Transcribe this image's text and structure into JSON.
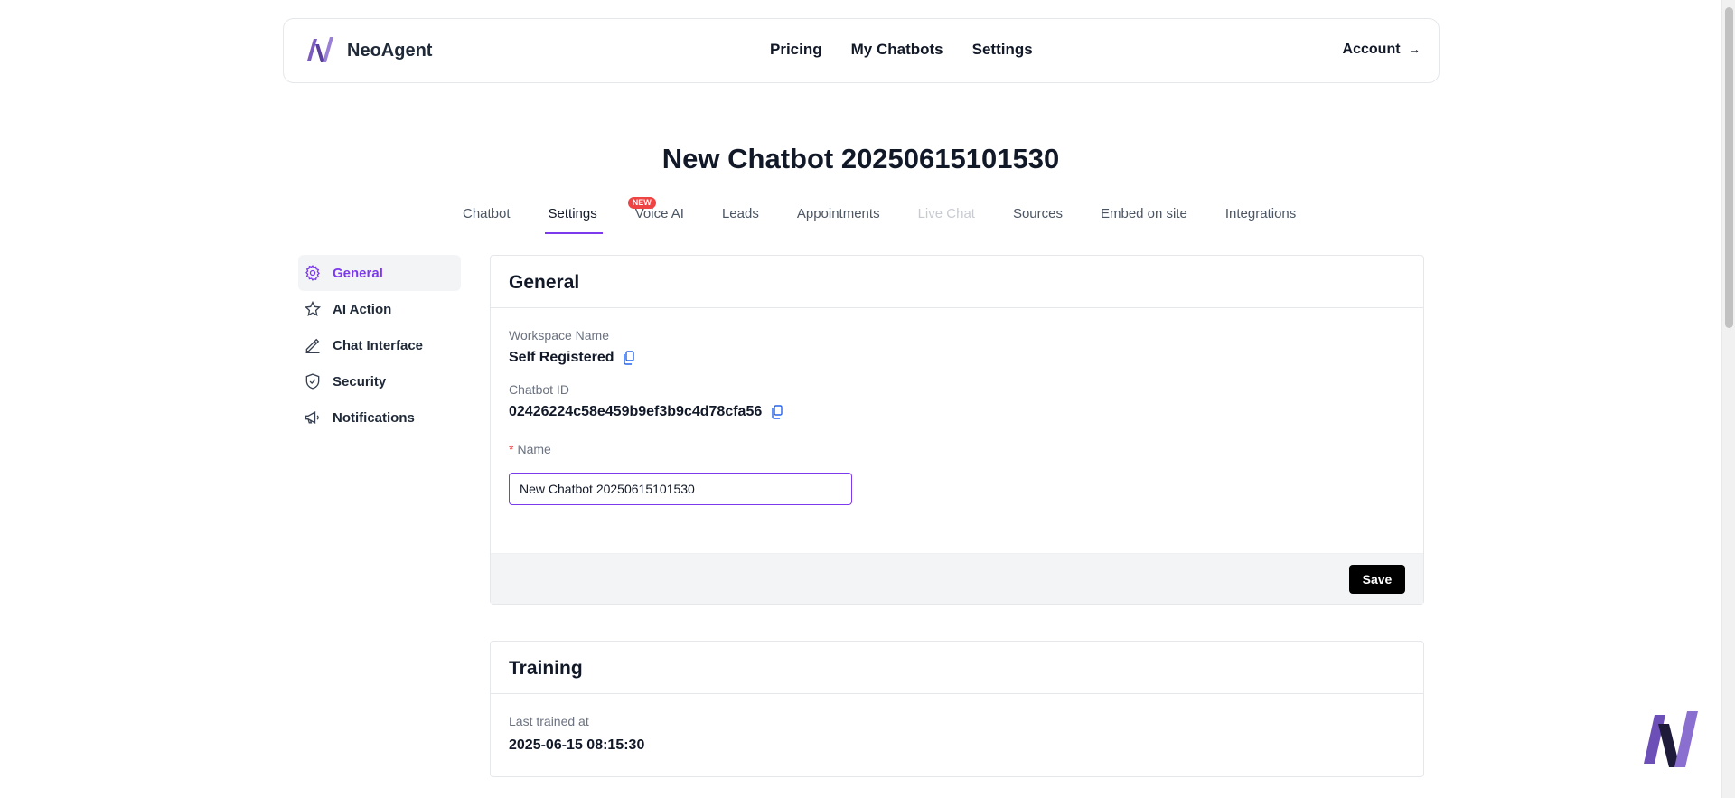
{
  "navbar": {
    "brand_name": "NeoAgent",
    "links": [
      "Pricing",
      "My Chatbots",
      "Settings"
    ],
    "account_label": "Account",
    "account_arrow": "→"
  },
  "page": {
    "title": "New Chatbot 20250615101530"
  },
  "tabs": [
    {
      "label": "Chatbot"
    },
    {
      "label": "Settings",
      "active": true
    },
    {
      "label": "Voice AI",
      "badge": "NEW"
    },
    {
      "label": "Leads"
    },
    {
      "label": "Appointments"
    },
    {
      "label": "Live Chat",
      "disabled": true
    },
    {
      "label": "Sources"
    },
    {
      "label": "Embed on site"
    },
    {
      "label": "Integrations"
    }
  ],
  "sidebar": {
    "items": [
      {
        "label": "General",
        "icon": "gear-icon",
        "active": true
      },
      {
        "label": "AI Action",
        "icon": "star-icon"
      },
      {
        "label": "Chat Interface",
        "icon": "pencil-icon"
      },
      {
        "label": "Security",
        "icon": "shield-check-icon"
      },
      {
        "label": "Notifications",
        "icon": "megaphone-icon"
      }
    ]
  },
  "general": {
    "title": "General",
    "workspace_label": "Workspace Name",
    "workspace_value": "Self Registered",
    "chatbot_id_label": "Chatbot ID",
    "chatbot_id_value": "02426224c58e459b9ef3b9c4d78cfa56",
    "name_required_mark": "*",
    "name_label": "Name",
    "name_value": "New Chatbot 20250615101530",
    "save_label": "Save"
  },
  "training": {
    "title": "Training",
    "last_trained_label": "Last trained at",
    "last_trained_value": "2025-06-15 08:15:30"
  },
  "colors": {
    "accent": "#7c3aed",
    "badge": "#ef4444",
    "button": "#000000"
  }
}
